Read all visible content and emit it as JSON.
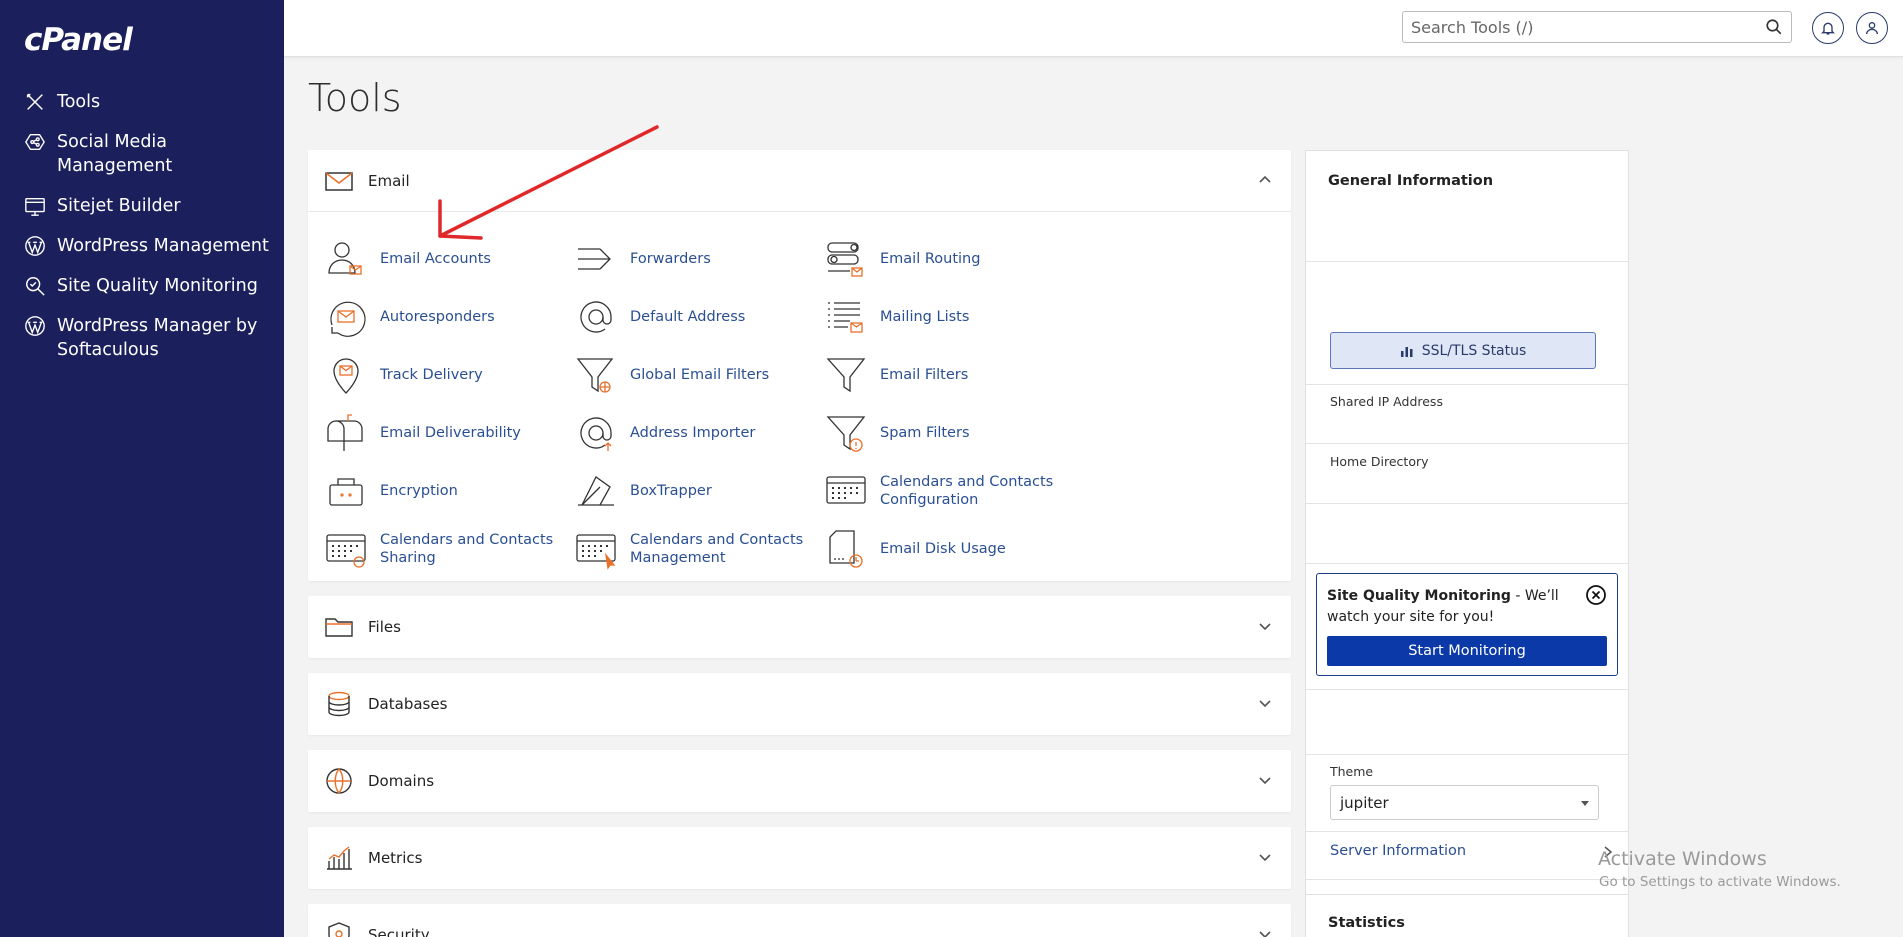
{
  "app": {
    "logo": "cPanel"
  },
  "sidebar": {
    "items": [
      {
        "label": "Tools",
        "icon": "tools-icon"
      },
      {
        "label": "Social Media Management",
        "icon": "social-media-icon"
      },
      {
        "label": "Sitejet Builder",
        "icon": "sitejet-icon"
      },
      {
        "label": "WordPress Management",
        "icon": "wordpress-icon"
      },
      {
        "label": "Site Quality Monitoring",
        "icon": "site-quality-icon"
      },
      {
        "label": "WordPress Manager by Softaculous",
        "icon": "wordpress-icon"
      }
    ]
  },
  "header": {
    "search_placeholder": "Search Tools (/)"
  },
  "page": {
    "title": "Tools"
  },
  "sections": {
    "email": {
      "title": "Email",
      "tools": [
        "Email Accounts",
        "Forwarders",
        "Email Routing",
        "Autoresponders",
        "Default Address",
        "Mailing Lists",
        "Track Delivery",
        "Global Email Filters",
        "Email Filters",
        "Email Deliverability",
        "Address Importer",
        "Spam Filters",
        "Encryption",
        "BoxTrapper",
        "Calendars and Contacts Configuration",
        "Calendars and Contacts Sharing",
        "Calendars and Contacts Management",
        "Email Disk Usage"
      ]
    },
    "files": {
      "title": "Files"
    },
    "databases": {
      "title": "Databases"
    },
    "domains": {
      "title": "Domains"
    },
    "metrics": {
      "title": "Metrics"
    },
    "security": {
      "title": "Security"
    }
  },
  "general_info": {
    "title": "General Information",
    "ssl_button": "SSL/TLS Status",
    "shared_ip_label": "Shared IP Address",
    "home_dir_label": "Home Directory",
    "sqm": {
      "bold": "Site Quality Monitoring",
      "text": " - We’ll watch your site for you!",
      "button": "Start Monitoring"
    },
    "theme_label": "Theme",
    "theme_value": "jupiter",
    "server_info": "Server Information"
  },
  "statistics": {
    "title": "Statistics"
  },
  "watermark": {
    "line1": "Activate Windows",
    "line2": "Go to Settings to activate Windows."
  },
  "colors": {
    "sidebar_bg": "#1b1f5c",
    "link": "#2a4f93",
    "accent_orange": "#e8702a",
    "primary_button": "#0b3aa8",
    "annotation_arrow": "#e0282b"
  }
}
